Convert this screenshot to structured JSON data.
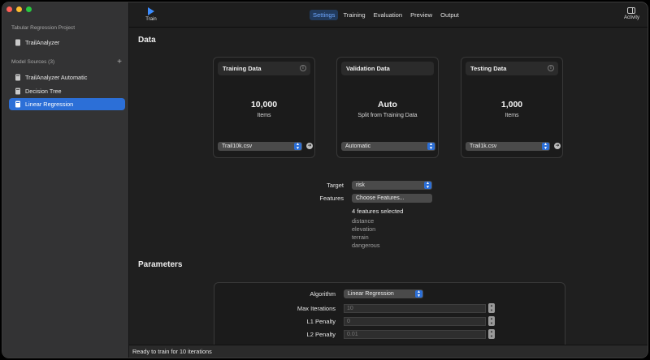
{
  "sidebar": {
    "project_title": "Tabular Regression Project",
    "project_item": "TrailAnalyzer",
    "sources_title": "Model Sources (3)",
    "add_label": "+",
    "items": [
      {
        "label": "TrailAnalyzer Automatic",
        "selected": false
      },
      {
        "label": "Decision Tree",
        "selected": false
      },
      {
        "label": "Linear Regression",
        "selected": true
      }
    ]
  },
  "toolbar": {
    "train_label": "Train",
    "tabs": [
      "Settings",
      "Training",
      "Evaluation",
      "Preview",
      "Output"
    ],
    "active_tab": "Settings",
    "activity_label": "Activity",
    "accent": "#3b8cff"
  },
  "data_section": {
    "title": "Data",
    "cards": [
      {
        "title": "Training Data",
        "big": "10,000",
        "sub": "Items",
        "popup": "Trail10k.csv"
      },
      {
        "title": "Validation Data",
        "big": "Auto",
        "sub": "Split from Training Data",
        "popup": "Automatic"
      },
      {
        "title": "Testing Data",
        "big": "1,000",
        "sub": "Items",
        "popup": "Trail1k.csv"
      }
    ],
    "target_label": "Target",
    "target_value": "risk",
    "features_label": "Features",
    "features_button": "Choose Features...",
    "features_count": "4 features selected",
    "features": [
      "distance",
      "elevation",
      "terrain",
      "dangerous"
    ]
  },
  "parameters": {
    "title": "Parameters",
    "algorithm_label": "Algorithm",
    "algorithm_value": "Linear Regression",
    "max_iter_label": "Max Iterations",
    "max_iter_value": "10",
    "l1_label": "L1 Penalty",
    "l1_value": "0",
    "l2_label": "L2 Penalty",
    "l2_value": "0.01"
  },
  "status": {
    "text": "Ready to train for 10 iterations"
  }
}
